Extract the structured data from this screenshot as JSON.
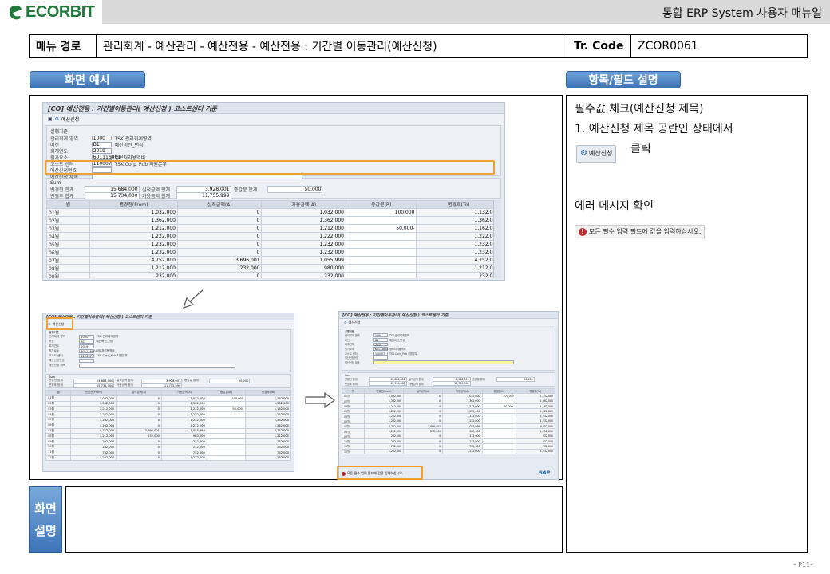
{
  "header": {
    "logo_text": "ECORBIT",
    "manual_title": "통합 ERP System 사용자 매뉴얼"
  },
  "menu": {
    "path_label": "메뉴 경로",
    "path_value": "관리회계 - 예산관리 - 예산전용 - 예산전용 : 기간별 이동관리(예산신청)",
    "tcode_label": "Tr. Code",
    "tcode_value": "ZCOR0061"
  },
  "sections": {
    "screen_example": "화면 예시",
    "field_desc": "항목/필드 설명",
    "screen_desc_1": "화면",
    "screen_desc_2": "설명"
  },
  "field_panel": {
    "line1": "필수값 체크(예산신청 제목)",
    "line2": "1.  예산신청 제목 공란인 상태에서",
    "button_label": "예산신청",
    "click": "클릭",
    "line3": "에러 메시지 확인",
    "error_message": "모든 필수 입력 필드에 값을 입력하십시오."
  },
  "sap": {
    "title": "[CO] 예산전용 : 기간별이동관리( 예산신청 ) 코스트센터 기준",
    "toolbar_button": "예산신청",
    "group_title": "실행기준",
    "fields": [
      {
        "label": "관리회계 영역",
        "value": "1000",
        "desc": "TSK 관리회계영역"
      },
      {
        "label": "버전",
        "value": "B1",
        "desc": "예산버전_편성"
      },
      {
        "label": "회계연도",
        "value": "2019",
        "desc": ""
      },
      {
        "label": "원가요소",
        "value": "601116001",
        "desc": "정보처리용역비"
      },
      {
        "label": "코스트 센터",
        "value": "110007",
        "desc": "TSK.Corp_Pub 지원본부"
      },
      {
        "label": "예산신청번호",
        "value": "",
        "desc": ""
      },
      {
        "label": "예산신청 제목",
        "value": "",
        "desc": ""
      }
    ],
    "sum_title": "Sum",
    "sum_rows": [
      [
        {
          "label": "변경전 합계",
          "value": "15,684,000"
        },
        {
          "label": "실적금액 합계",
          "value": "3,928,001"
        },
        {
          "label": "증감분 합계",
          "value": "50,000"
        }
      ],
      [
        {
          "label": "변경후 합계",
          "value": "15,734,000"
        },
        {
          "label": "가용금액 합계",
          "value": "11,755,999"
        },
        {
          "label": "",
          "value": ""
        }
      ]
    ],
    "columns": [
      "월",
      "변경전(From)",
      "실적금액(A)",
      "가용금액(A)",
      "증감분(B)",
      "변경후(To)"
    ],
    "rows": [
      [
        "01월",
        "1,032,000",
        "0",
        "1,032,000",
        "100,000",
        "1,132,000"
      ],
      [
        "02월",
        "1,362,000",
        "0",
        "1,362,000",
        "",
        "1,362,000"
      ],
      [
        "03월",
        "1,212,000",
        "0",
        "1,212,000",
        "50,000-",
        "1,162,000"
      ],
      [
        "04월",
        "1,222,000",
        "0",
        "1,222,000",
        "",
        "1,222,000"
      ],
      [
        "05월",
        "1,232,000",
        "0",
        "1,232,000",
        "",
        "1,232,000"
      ],
      [
        "06월",
        "1,232,000",
        "0",
        "1,232,000",
        "",
        "1,232,000"
      ],
      [
        "07월",
        "4,752,000",
        "3,696,001",
        "1,055,999",
        "",
        "4,752,000"
      ],
      [
        "08월",
        "1,212,000",
        "232,000",
        "980,000",
        "",
        "1,212,000"
      ],
      [
        "09월",
        "232,000",
        "0",
        "232,000",
        "",
        "232,000"
      ],
      [
        "10월",
        "232,000",
        "0",
        "232,000",
        "",
        "232,000"
      ],
      [
        "11월",
        "732,000",
        "0",
        "732,000",
        "",
        "732,000"
      ],
      [
        "12월",
        "1,232,000",
        "0",
        "1,232,000",
        "",
        "1,232,000"
      ]
    ],
    "error_message": "모든 필수 입력 필드에 값을 입력하십시오."
  },
  "page_number": "- P11-"
}
